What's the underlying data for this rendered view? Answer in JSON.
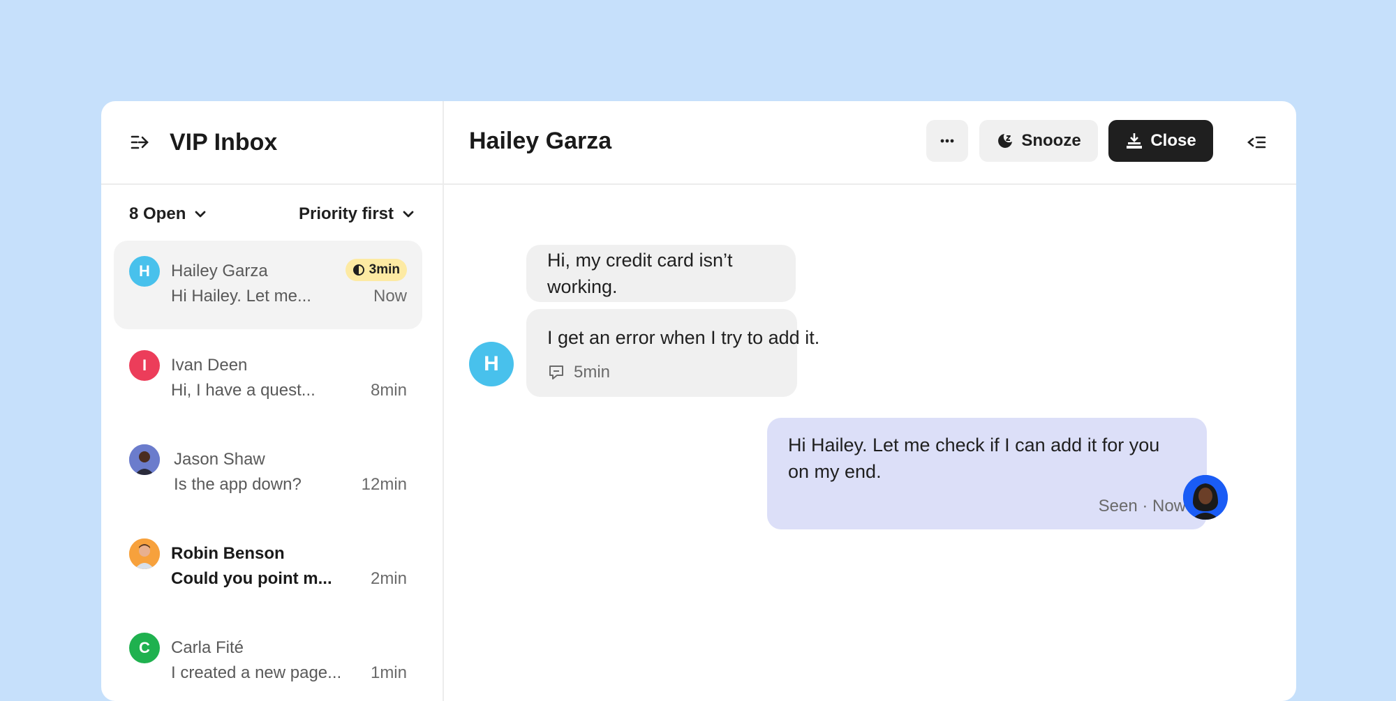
{
  "sidebar": {
    "title": "VIP Inbox",
    "filter_status": "8 Open",
    "filter_sort": "Priority first"
  },
  "conversations": [
    {
      "initial": "H",
      "name": "Hailey Garza",
      "preview": "Hi Hailey. Let me...",
      "time": "Now",
      "badge": "3min",
      "avatar_color": "#48c1ec"
    },
    {
      "initial": "I",
      "name": "Ivan Deen",
      "preview": "Hi, I have a quest...",
      "time": "8min",
      "avatar_color": "#ec3d5a"
    },
    {
      "initial": "",
      "name": "Jason Shaw",
      "preview": "Is the app down?",
      "time": "12min",
      "avatar_color": "#5b6cc4"
    },
    {
      "initial": "",
      "name": "Robin Benson",
      "preview": "Could you point m...",
      "time": "2min",
      "avatar_color": "#f7a13c"
    },
    {
      "initial": "C",
      "name": "Carla Fité",
      "preview": "I created a new page...",
      "time": "1min",
      "avatar_color": "#1fb14f"
    }
  ],
  "conversation": {
    "contact_name": "Hailey Garza",
    "snooze_label": "Snooze",
    "close_label": "Close",
    "customer_initial": "H",
    "messages_in": [
      "Hi, my credit card isn’t working.",
      "I get an error when I try to add it."
    ],
    "in_meta": "5min",
    "message_out": "Hi Hailey. Let me check if I can add it for you on my end.",
    "out_meta": "Seen · Now"
  },
  "colors": {
    "background": "#c6e0fb",
    "accent_dark": "#1f1f1f",
    "outgoing_bubble": "#dcdff8",
    "badge": "#fdeaa3"
  }
}
